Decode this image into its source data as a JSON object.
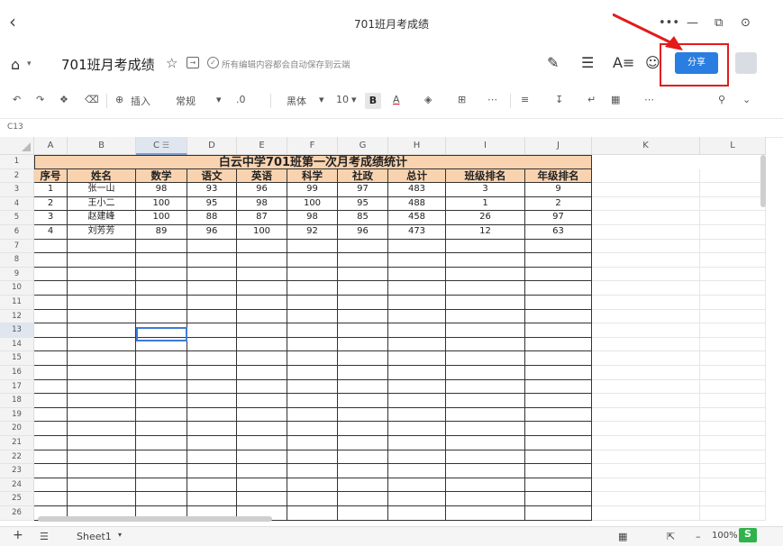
{
  "window": {
    "title": "701班月考成绩",
    "back_icon": "chevron-left-icon",
    "controls": [
      "•••",
      "—",
      "⧉",
      "⊙"
    ]
  },
  "doc": {
    "name": "701班月考成绩",
    "save_status": "所有编辑内容都会自动保存到云端",
    "share_label": "分享"
  },
  "toolbar": {
    "insert_label": "插入",
    "format_label": "常规",
    "decimal_label": ".0",
    "font_label": "黑体",
    "size_label": "10",
    "bold_label": "B",
    "font_color_label": "A"
  },
  "formula": {
    "cell_ref": "C13"
  },
  "columns": [
    "A",
    "B",
    "C",
    "D",
    "E",
    "F",
    "G",
    "H",
    "I",
    "J",
    "K",
    "L"
  ],
  "sheet": {
    "title": "白云中学701班第一次月考成绩统计",
    "headers": [
      "序号",
      "姓名",
      "数学",
      "语文",
      "英语",
      "科学",
      "社政",
      "总计",
      "班级排名",
      "年级排名"
    ],
    "rows": [
      [
        "1",
        "张一山",
        "98",
        "93",
        "96",
        "99",
        "97",
        "483",
        "3",
        "9"
      ],
      [
        "2",
        "王小二",
        "100",
        "95",
        "98",
        "100",
        "95",
        "488",
        "1",
        "2"
      ],
      [
        "3",
        "赵建峰",
        "100",
        "88",
        "87",
        "98",
        "85",
        "458",
        "26",
        "97"
      ],
      [
        "4",
        "刘芳芳",
        "89",
        "96",
        "100",
        "92",
        "96",
        "473",
        "12",
        "63"
      ]
    ]
  },
  "sheetbar": {
    "add_label": "+",
    "tab_label": "Sheet1",
    "zoom": "100%"
  },
  "colors": {
    "header_fill": "#f9d3b0",
    "accent": "#2a7de1",
    "highlight": "#e31b1b"
  }
}
